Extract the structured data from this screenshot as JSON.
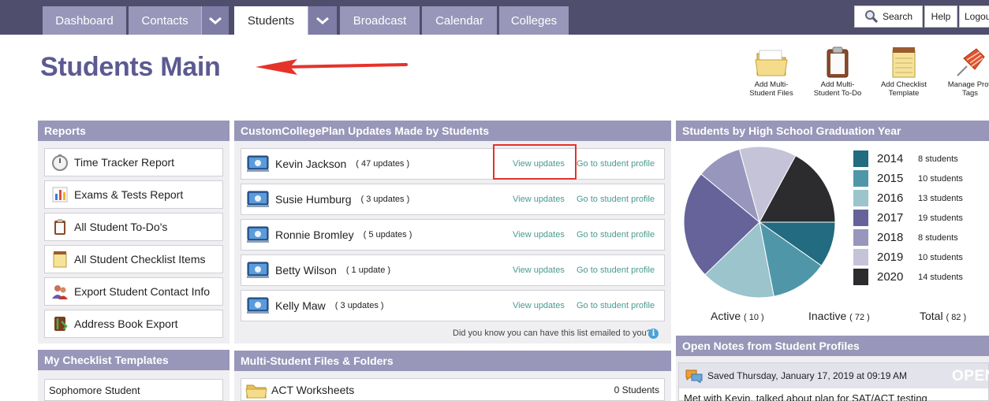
{
  "nav": {
    "tabs": [
      {
        "label": "Dashboard"
      },
      {
        "label": "Contacts"
      },
      {
        "label": "Students"
      },
      {
        "label": "Broadcast"
      },
      {
        "label": "Calendar"
      },
      {
        "label": "Colleges"
      }
    ],
    "search_label": "Search",
    "help_label": "Help",
    "logout_label": "Logou"
  },
  "page_title": "Students Main",
  "quick_actions": [
    {
      "label_line1": "Add Multi-",
      "label_line2": "Student Files",
      "icon": "folder-icon"
    },
    {
      "label_line1": "Add Multi-",
      "label_line2": "Student To-Do",
      "icon": "clipboard-icon"
    },
    {
      "label_line1": "Add Checklist",
      "label_line2": "Template",
      "icon": "notepad-icon"
    },
    {
      "label_line1": "Manage Profi",
      "label_line2": "Tags",
      "icon": "pushpin-icon"
    }
  ],
  "reports": {
    "title": "Reports",
    "items": [
      {
        "label": "Time Tracker Report",
        "icon": "stopwatch-icon"
      },
      {
        "label": "Exams & Tests Report",
        "icon": "bar-chart-icon"
      },
      {
        "label": "All Student To-Do's",
        "icon": "clipboard-icon"
      },
      {
        "label": "All Student Checklist Items",
        "icon": "notepad-icon"
      },
      {
        "label": "Export Student Contact Info",
        "icon": "contacts-icon"
      },
      {
        "label": "Address Book Export",
        "icon": "address-book-icon"
      }
    ]
  },
  "updates": {
    "title": "CustomCollegePlan Updates Made by Students",
    "view_label": "View updates",
    "goto_label": "Go to student profile",
    "rows": [
      {
        "name": "Kevin Jackson",
        "count": "( 47 updates )"
      },
      {
        "name": "Susie Humburg",
        "count": "( 3 updates )"
      },
      {
        "name": "Ronnie Bromley",
        "count": "( 5 updates )"
      },
      {
        "name": "Betty Wilson",
        "count": "( 1 update )"
      },
      {
        "name": "Kelly Maw",
        "count": "( 3 updates )"
      }
    ],
    "footer": "Did you know you can have this list emailed to you?"
  },
  "graduation": {
    "title": "Students by High School Graduation Year",
    "legend": [
      {
        "year": "2014",
        "count": "8 students",
        "color": "#226b80"
      },
      {
        "year": "2015",
        "count": "10 students",
        "color": "#4f97a8"
      },
      {
        "year": "2016",
        "count": "13 students",
        "color": "#9bc4cc"
      },
      {
        "year": "2017",
        "count": "19 students",
        "color": "#66639a"
      },
      {
        "year": "2018",
        "count": "8 students",
        "color": "#9896bd"
      },
      {
        "year": "2019",
        "count": "10 students",
        "color": "#c4c3d8"
      },
      {
        "year": "2020",
        "count": "14 students",
        "color": "#2c2c2e"
      }
    ],
    "active_label": "Active",
    "active_count": "( 10 )",
    "inactive_label": "Inactive",
    "inactive_count": "( 72 )",
    "total_label": "Total",
    "total_count": "( 82 )"
  },
  "chart_data": {
    "type": "pie",
    "categories": [
      "2014",
      "2015",
      "2016",
      "2017",
      "2018",
      "2019",
      "2020"
    ],
    "values": [
      8,
      10,
      13,
      19,
      8,
      10,
      14
    ],
    "colors": [
      "#226b80",
      "#4f97a8",
      "#9bc4cc",
      "#66639a",
      "#9896bd",
      "#c4c3d8",
      "#2c2c2e"
    ],
    "title": "Students by High School Graduation Year",
    "legend": "right"
  },
  "checklist": {
    "title": "My Checklist Templates",
    "items": [
      {
        "label": "Sophomore Student"
      }
    ]
  },
  "files": {
    "title": "Multi-Student Files & Folders",
    "items": [
      {
        "name": "ACT Worksheets",
        "count": "0 Students"
      }
    ]
  },
  "notes": {
    "title": "Open Notes from Student Profiles",
    "saved": "Saved Thursday, January 17, 2019 at 09:19 AM",
    "status": "OPEN",
    "text": "Met with Kevin, talked about plan for SAT/ACT testing"
  }
}
